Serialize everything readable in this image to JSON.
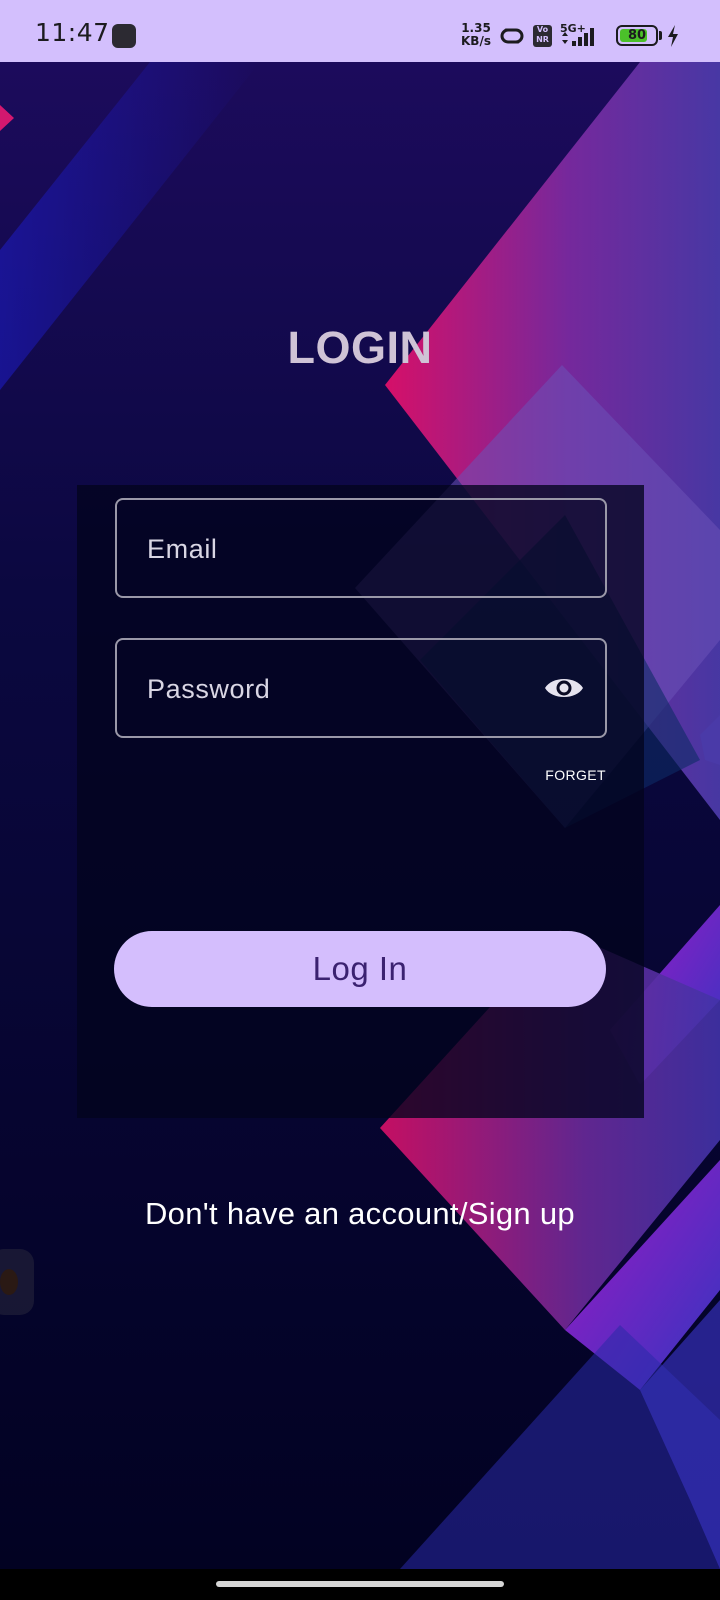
{
  "status_bar": {
    "time": "11:47",
    "net_speed_value": "1.35",
    "net_speed_unit": "KB/s",
    "volte_top": "Vo",
    "volte_bottom": "NR",
    "network_type": "5G+",
    "battery_level": "80",
    "battery_fill": 0.8,
    "background_color": "#d3bffd"
  },
  "login": {
    "title": "LOGIN",
    "email_placeholder": "Email",
    "password_placeholder": "Password",
    "forget_label": "FORGET",
    "login_button_label": "Log In",
    "signup_link_label": "Don't have an account/Sign up"
  },
  "icons": {
    "password_toggle": "eye-icon",
    "status_hotspot": "hotspot-icon",
    "status_signal": "signal-icon",
    "status_charging": "charging-icon"
  },
  "colors": {
    "button_background": "#d4befd",
    "button_text": "#3b2270",
    "title_text": "#cfc3d6",
    "background_dark": "#030322",
    "accent_magenta": "#e4126b",
    "accent_blue": "#1b1bd8"
  }
}
